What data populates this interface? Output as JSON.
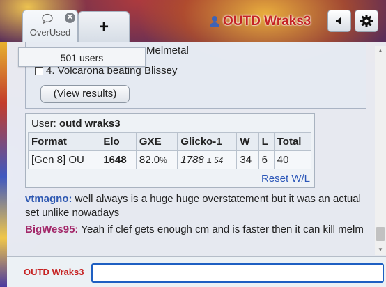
{
  "header": {
    "room_tab_label": "OverUsed",
    "add_tab_label": "+",
    "username": "OUTD Wraks3"
  },
  "poll": {
    "option_3": "Melmetal",
    "option_4": "4. Volcarona beating Blissey",
    "view_results": "(View results)"
  },
  "users_popup": {
    "label": "501 users"
  },
  "ladder": {
    "user_label": "User:",
    "user_name": "outd wraks3",
    "columns": [
      "Format",
      "Elo",
      "GXE",
      "Glicko-1",
      "W",
      "L",
      "Total"
    ],
    "row": {
      "format": "[Gen 8] OU",
      "elo": "1648",
      "gxe": "82.0",
      "gxe_unit": "%",
      "glicko": "1788",
      "glicko_dev": "± 54",
      "w": "34",
      "l": "6",
      "total": "40"
    },
    "reset_link": "Reset W/L"
  },
  "messages": [
    {
      "author": "vtmagno:",
      "text": "well always is a huge huge overstatement but it was an actual set unlike nowadays",
      "color": "#2f59b2"
    },
    {
      "author": "BigWes95:",
      "text": "Yeah if clef gets enough cm and is faster then it can kill melm",
      "color": "#a3286a"
    }
  ],
  "input": {
    "name_label": "OUTD Wraks3",
    "value": ""
  },
  "colors": {
    "username": "#c62424",
    "link": "#2a56b8",
    "input_border": "#1e5fc2"
  },
  "icons": [
    "chat-bubble-icon",
    "close-icon",
    "user-icon",
    "sound-icon",
    "gear-icon"
  ]
}
